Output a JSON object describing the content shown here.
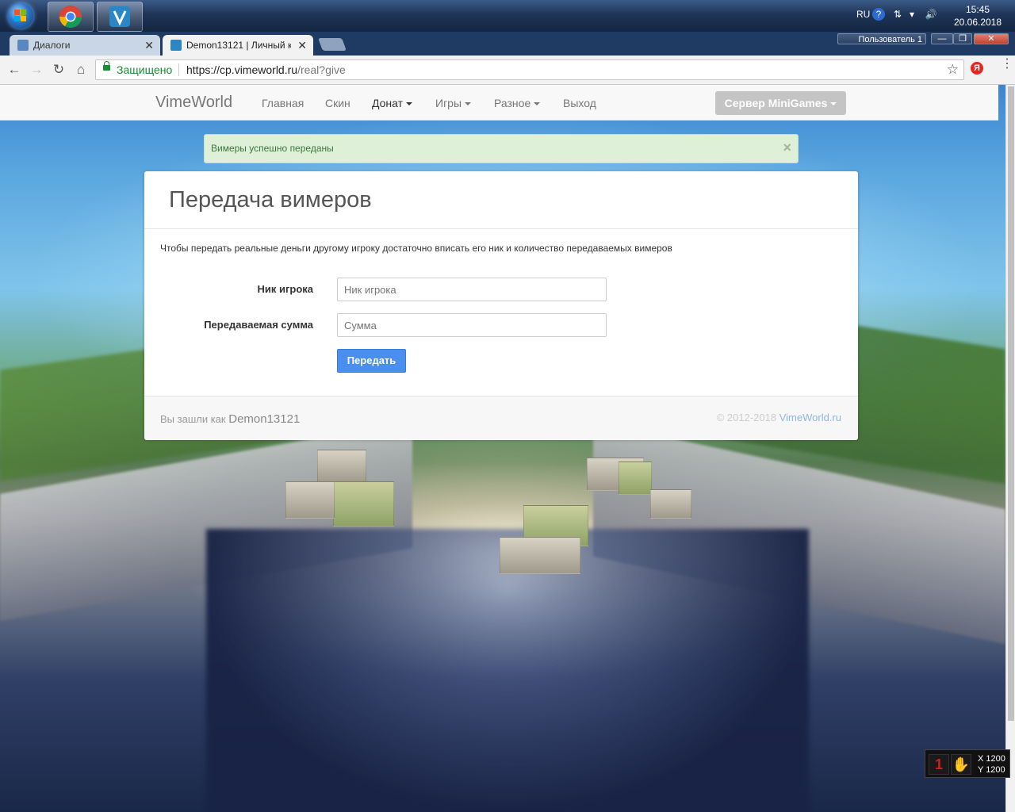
{
  "taskbar": {
    "lang": "RU",
    "time": "15:45",
    "date": "20.06.2018"
  },
  "tabs": [
    {
      "label": "Диалоги",
      "close": "✕"
    },
    {
      "label": "Demon13121 | Личный к",
      "close": "✕"
    }
  ],
  "window": {
    "profile_label": "Пользователь 1",
    "minimize": "—",
    "maximize": "❐",
    "close": "✕"
  },
  "address": {
    "secure_label": "Защищено",
    "url_host": "https://cp.vimeworld.ru",
    "url_path": "/real?give"
  },
  "navbar": {
    "brand": "VimeWorld",
    "items": [
      {
        "label": "Главная"
      },
      {
        "label": "Скин"
      },
      {
        "label": "Донат"
      },
      {
        "label": "Игры"
      },
      {
        "label": "Разное"
      },
      {
        "label": "Выход"
      }
    ],
    "server_button": "Сервер MiniGames"
  },
  "alert": {
    "message": "Вимеры успешно переданы",
    "close": "×"
  },
  "panel": {
    "title": "Передача вимеров",
    "description": "Чтобы передать реальные деньги другому игроку достаточно вписать его ник и количество передаваемых вимеров",
    "fields": {
      "nick": {
        "label": "Ник игрока",
        "placeholder": "Ник игрока"
      },
      "amount": {
        "label": "Передаваемая сумма",
        "placeholder": "Сумма"
      }
    },
    "submit": "Передать",
    "footer": {
      "logged_in_prefix": "Вы зашли как",
      "nick": "Demon13121",
      "copyright": "© 2012-2018",
      "copyright_link": "VimeWorld.ru"
    }
  },
  "overlay": {
    "x_label": "X 1200",
    "y_label": "Y 1200"
  },
  "colors": {
    "primary_button": "#4a8ef0",
    "alert_bg": "#dff0d8",
    "alert_text": "#3c763d",
    "secure_green": "#1a8a34"
  }
}
